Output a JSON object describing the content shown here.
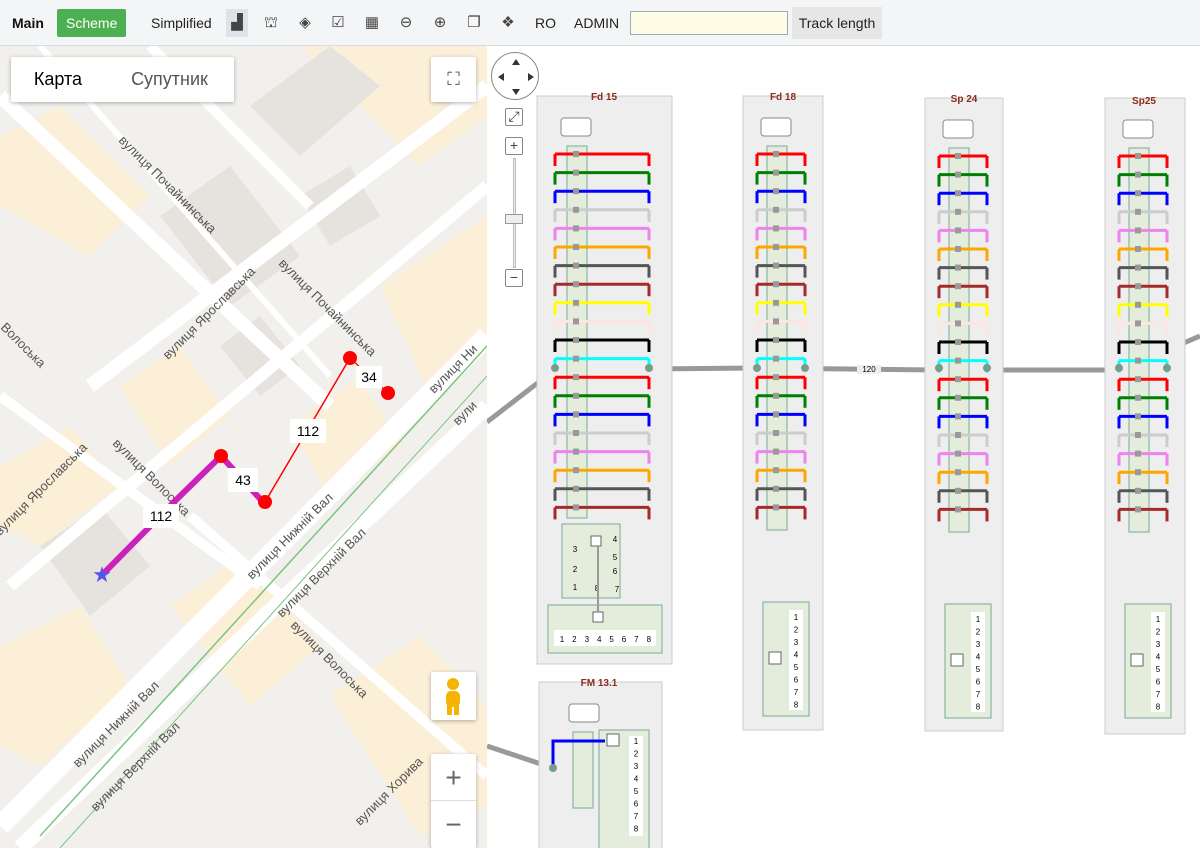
{
  "toolbar": {
    "main": "Main",
    "scheme": "Scheme",
    "simplified": "Simplified",
    "ro": "RO",
    "admin": "ADMIN",
    "search_value": "",
    "track_length": "Track length",
    "icons": [
      "map-icon",
      "tree-icon",
      "layers-icon",
      "checkbox-icon",
      "calendar-icon",
      "arrow-left-icon",
      "arrow-right-icon",
      "copy-icon",
      "dropbox-icon"
    ]
  },
  "map": {
    "type_map": "Карта",
    "type_satellite": "Супутник",
    "zoom_in": "+",
    "zoom_out": "−",
    "streets": [
      "вулиця Почайнинська",
      "вулиця Почайнинська",
      "вулиця Ярославська",
      "вулиця Ярославська",
      "вулиця Волоська",
      "вулиця Волоська",
      "вулиця Нижній Вал",
      "вулиця Верхній Вал",
      "вулиця Нижній Вал",
      "вулиця Верхній Вал",
      "вулиця Ни",
      "вули",
      "вулиця Хорива",
      "Волоська"
    ],
    "route_labels": [
      "34",
      "112",
      "43",
      "112"
    ]
  },
  "scheme": {
    "boxes": [
      {
        "name": "Fd 15"
      },
      {
        "name": "Fd 18"
      },
      {
        "name": "Sp 24"
      },
      {
        "name": "Sp25"
      },
      {
        "name": "FM 13.1"
      }
    ],
    "cable_label": "120",
    "port_numbers": [
      "1",
      "2",
      "3",
      "4",
      "5",
      "6",
      "7",
      "8"
    ],
    "fiber_colors": [
      "#ff0000",
      "#008000",
      "#0000ff",
      "#cccccc",
      "#ee82ee",
      "#ffa500",
      "#555555",
      "#a52a2a",
      "#ffff00",
      "#ffe4e1",
      "#000000",
      "#00ffff"
    ]
  }
}
